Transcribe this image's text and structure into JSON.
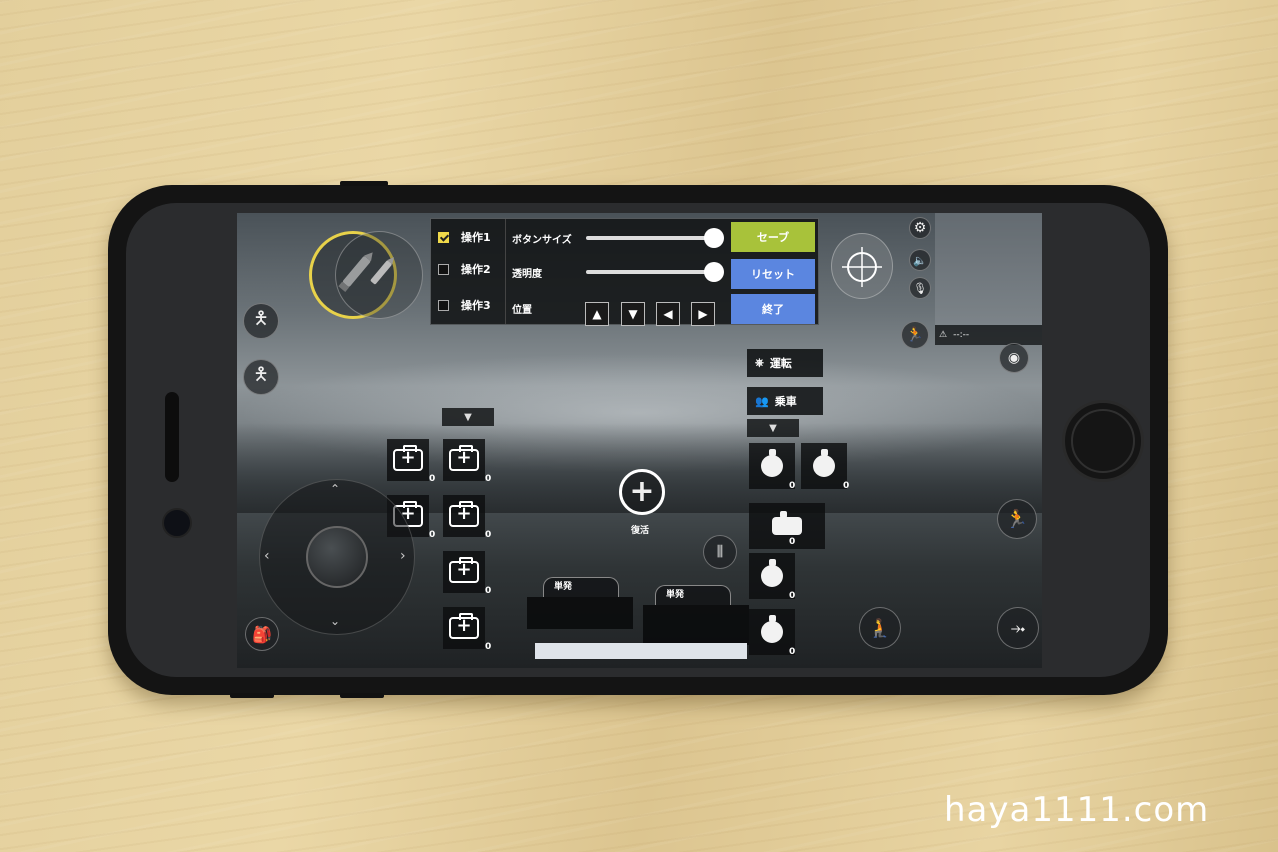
{
  "settings_panel": {
    "options": [
      {
        "label": "操作1",
        "checked": true
      },
      {
        "label": "操作2",
        "checked": false
      },
      {
        "label": "操作3",
        "checked": false
      }
    ],
    "button_size_label": "ボタンサイズ",
    "opacity_label": "透明度",
    "position_label": "位置",
    "button_size_value": 1.0,
    "opacity_value": 1.0,
    "save_label": "セーブ",
    "reset_label": "リセット",
    "exit_label": "終了",
    "arrows": [
      "▲",
      "▼",
      "◀",
      "▶"
    ],
    "colors": {
      "save": "#a8c23a",
      "reset": "#5b86e0",
      "exit": "#5b86e0"
    }
  },
  "revive": {
    "label": "復活",
    "icon": "plus-icon"
  },
  "vehicle": {
    "drive_label": "運転",
    "ride_label": "乗車"
  },
  "fire_modes": [
    {
      "label": "単発"
    },
    {
      "label": "単発"
    }
  ],
  "medkits": [
    {
      "count": "0"
    },
    {
      "count": "0"
    },
    {
      "count": "0"
    },
    {
      "count": "0"
    },
    {
      "count": "0"
    },
    {
      "count": "0"
    }
  ],
  "grenades": [
    {
      "count": "0"
    },
    {
      "count": "0"
    },
    {
      "count": "0"
    },
    {
      "count": "0"
    },
    {
      "count": "0"
    }
  ],
  "status_readout": "--:--",
  "watermark": "haya1111.com"
}
